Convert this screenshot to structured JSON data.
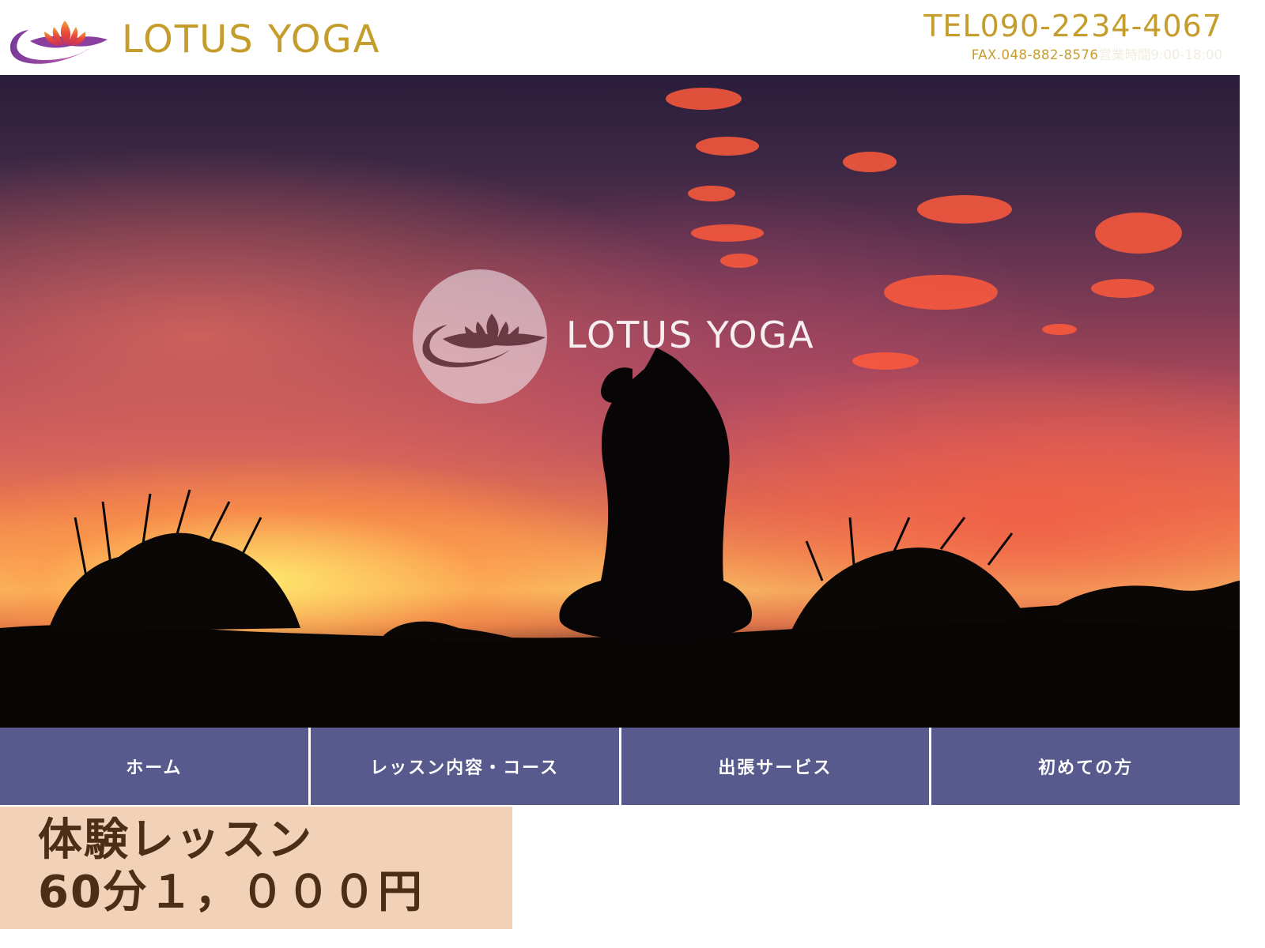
{
  "header": {
    "brand_name": "LOTUS YOGA",
    "brand_icon": "lotus-logo-icon",
    "tel_prefix": "TEL",
    "tel_number": "090-2234-4067",
    "fax": "FAX.048-882-8576",
    "hours": "営業時間9:00-18:00"
  },
  "hero": {
    "logo_text": "LOTUS YOGA",
    "logo_icon": "lotus-logo-icon",
    "image_subject": "yoga-silhouette-sunset"
  },
  "nav": {
    "items": [
      {
        "label": "ホーム"
      },
      {
        "label": "レッスン内容・コース"
      },
      {
        "label": "出張サービス"
      },
      {
        "label": "初めての方"
      }
    ]
  },
  "promo": {
    "line1": "体験レッスン",
    "line2": "60分１，０００円"
  },
  "colors": {
    "brand_gold": "#c59d2c",
    "nav_bg": "#58598c",
    "promo_bg": "#f1d2b8",
    "promo_text": "#4a2f16",
    "logo_purple": "#8a3fa0",
    "logo_flower": "#e8483a"
  }
}
